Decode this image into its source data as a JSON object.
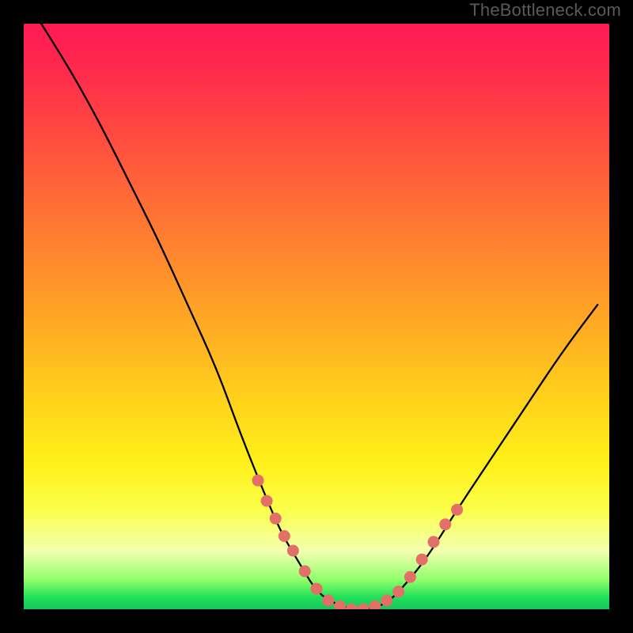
{
  "watermark": "TheBottleneck.com",
  "colors": {
    "page_bg": "#000000",
    "dot_fill": "#e27066",
    "curve_stroke": "#000000",
    "gradient_top": "#ff1a53",
    "gradient_bottom": "#18c65a"
  },
  "chart_data": {
    "type": "line",
    "title": "",
    "xlabel": "",
    "ylabel": "",
    "xlim": [
      0,
      100
    ],
    "ylim": [
      0,
      100
    ],
    "grid": false,
    "legend": false,
    "series": [
      {
        "name": "bottleneck-curve",
        "x": [
          3,
          8,
          13,
          18,
          23,
          28,
          33,
          37,
          41,
          44,
          47,
          50,
          53,
          56,
          59,
          62,
          65,
          69,
          74,
          80,
          86,
          92,
          98
        ],
        "y": [
          100,
          92,
          83,
          73,
          63,
          52,
          41,
          30,
          20,
          13,
          8,
          3,
          1,
          0,
          0,
          1,
          4,
          9,
          17,
          26,
          35,
          44,
          52
        ]
      }
    ],
    "markers": {
      "name": "highlighted-points",
      "comment": "salmon dots along the lower section of the curve",
      "x": [
        40,
        41.5,
        43,
        44.5,
        46,
        48,
        50,
        52,
        54,
        56,
        58,
        60,
        62,
        64,
        66,
        68,
        70,
        72,
        74
      ],
      "y": [
        22,
        18.5,
        15.5,
        12.5,
        10,
        6.5,
        3.5,
        1.5,
        0.5,
        0,
        0,
        0.5,
        1.5,
        3,
        5.5,
        8.5,
        11.5,
        14.5,
        17
      ]
    }
  }
}
